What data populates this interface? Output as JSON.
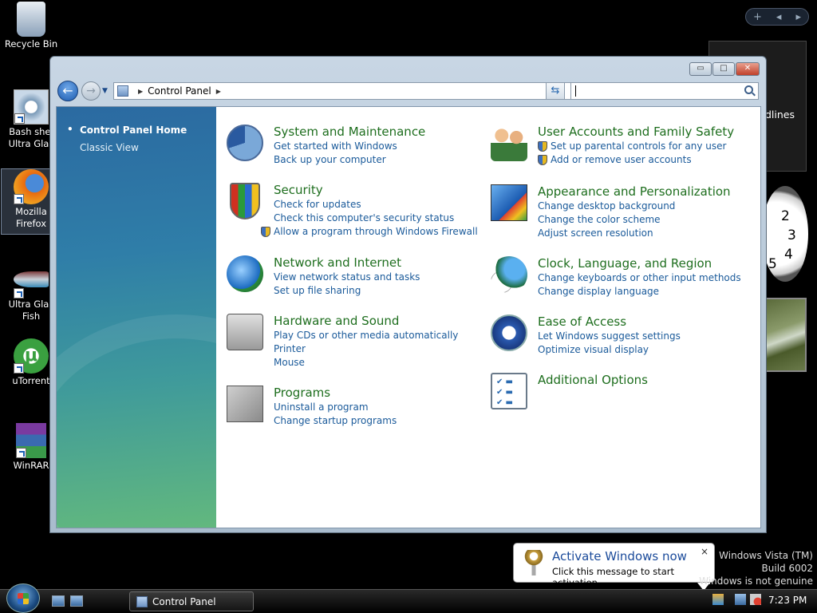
{
  "desktop": {
    "icons": [
      {
        "label": "Recycle Bin"
      },
      {
        "label": "Bash shel Ultra Glas"
      },
      {
        "label": "Mozilla Firefox"
      },
      {
        "label": "Ultra Glas Fish"
      },
      {
        "label": "uTorrent"
      },
      {
        "label": "WinRAR"
      }
    ],
    "gadgets": {
      "headlines_text": "dlines",
      "controls": [
        "+",
        "◂",
        "▸"
      ]
    }
  },
  "window": {
    "title": "Control Panel",
    "controls": {
      "minimize": "▭",
      "maximize": "□",
      "close": "✕"
    },
    "address": {
      "root": "Control Panel"
    },
    "search": {
      "placeholder": ""
    },
    "sidebar": {
      "home": "Control Panel Home",
      "classic": "Classic View"
    },
    "categories": [
      {
        "title": "System and Maintenance",
        "links": [
          "Get started with Windows",
          "Back up your computer"
        ]
      },
      {
        "title": "Security",
        "links": [
          "Check for updates",
          "Check this computer's security status",
          "Allow a program through Windows Firewall"
        ]
      },
      {
        "title": "Network and Internet",
        "links": [
          "View network status and tasks",
          "Set up file sharing"
        ]
      },
      {
        "title": "Hardware and Sound",
        "links": [
          "Play CDs or other media automatically",
          "Printer",
          "Mouse"
        ]
      },
      {
        "title": "Programs",
        "links": [
          "Uninstall a program",
          "Change startup programs"
        ]
      },
      {
        "title": "User Accounts and Family Safety",
        "links": [
          "Set up parental controls for any user",
          "Add or remove user accounts"
        ]
      },
      {
        "title": "Appearance and Personalization",
        "links": [
          "Change desktop background",
          "Change the color scheme",
          "Adjust screen resolution"
        ]
      },
      {
        "title": "Clock, Language, and Region",
        "links": [
          "Change keyboards or other input methods",
          "Change display language"
        ]
      },
      {
        "title": "Ease of Access",
        "links": [
          "Let Windows suggest settings",
          "Optimize visual display"
        ]
      },
      {
        "title": "Additional Options",
        "links": []
      }
    ]
  },
  "taskbar": {
    "task_label": "Control Panel",
    "time": "7:23 PM"
  },
  "balloon": {
    "title": "Activate Windows now",
    "message": "Click this message to start activation.",
    "close": "×"
  },
  "watermark": {
    "line1": "Windows Vista (TM)",
    "line2": "Build 6002",
    "line3": "Windows is not genuine"
  },
  "colors": {
    "category_title": "#1e6e1e",
    "link": "#1a5a9a",
    "sidebar_top": "#2b6aa1",
    "sidebar_bottom": "#62b87e"
  }
}
